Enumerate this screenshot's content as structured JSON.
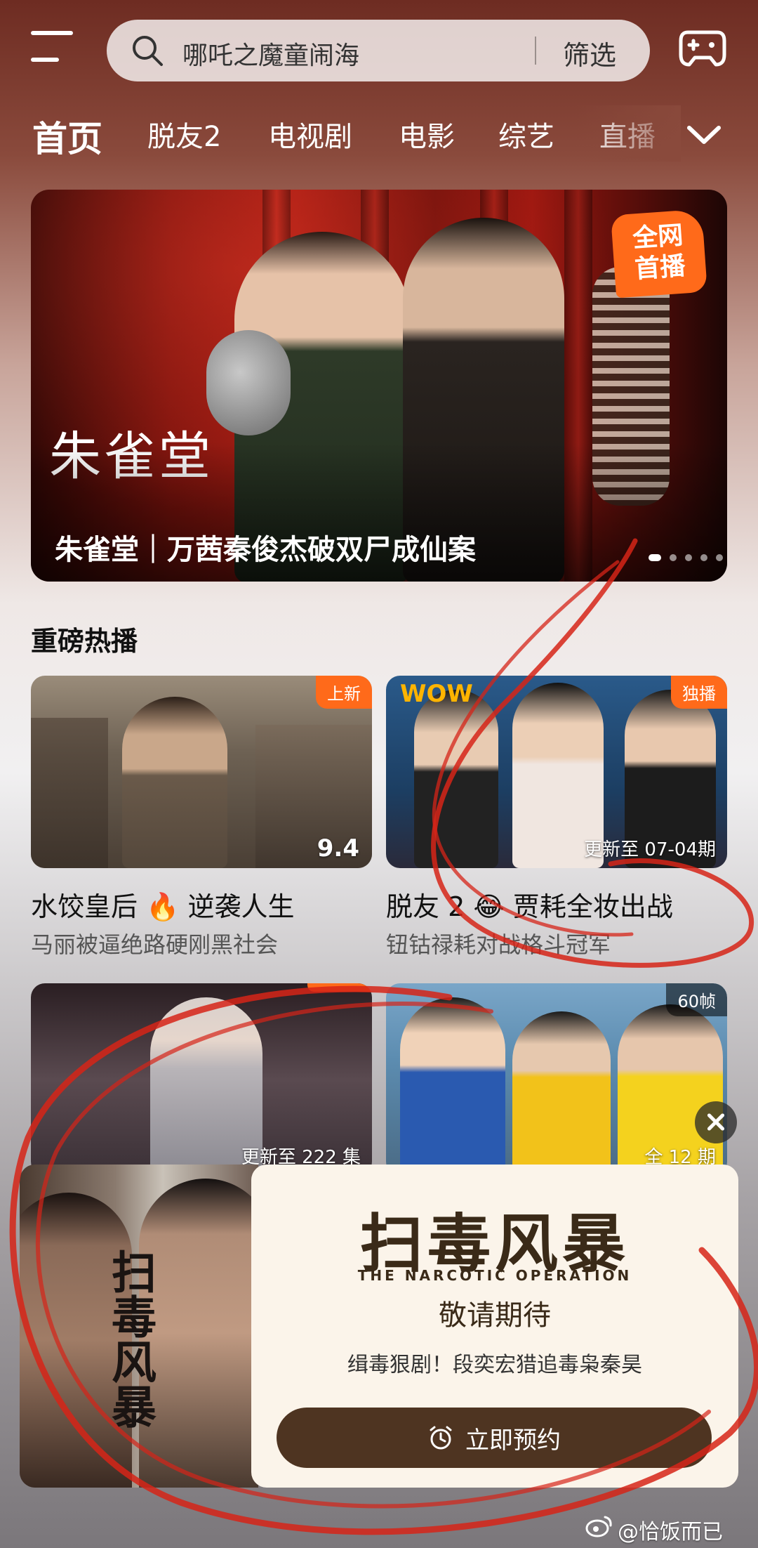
{
  "search": {
    "query": "哪吒之魔童闹海",
    "filter_label": "筛选"
  },
  "tabs": [
    {
      "label": "首页",
      "active": true
    },
    {
      "label": "脱友2"
    },
    {
      "label": "电视剧"
    },
    {
      "label": "电影"
    },
    {
      "label": "综艺"
    },
    {
      "label": "直播"
    }
  ],
  "banner": {
    "logo": "朱雀堂",
    "badge": "全网\n首播",
    "caption": "朱雀堂｜万茜秦俊杰破双尸成仙案",
    "slide_index": 1,
    "slide_count": 5
  },
  "section": {
    "title": "重磅热播"
  },
  "cards": [
    {
      "badge": "上新",
      "score": "9.4",
      "title": "水饺皇后 🔥 逆袭人生",
      "subtitle": "马丽被逼绝路硬刚黑社会"
    },
    {
      "badge": "独播",
      "note": "更新至 07-04期",
      "title": "脱友 2 😂 贾耗全妆出战",
      "subtitle": "钮钴禄耗对战格斗冠军"
    },
    {
      "badge": "",
      "note": "更新至 222 集"
    },
    {
      "badge": "60帧",
      "note": "全 12 期"
    }
  ],
  "popup": {
    "logo": "扫毒风暴",
    "logo_subtitle": "THE NARCOTIC OPERATION",
    "heading": "敬请期待",
    "description": "缉毒狠剧！段奕宏猎追毒枭秦昊",
    "button": "立即预约",
    "poster_title": "扫毒风暴"
  },
  "watermark": "@恰饭而已",
  "colors": {
    "accent": "#ff6a1a",
    "button_dark": "#4e3421",
    "scribble": "#d62418"
  }
}
